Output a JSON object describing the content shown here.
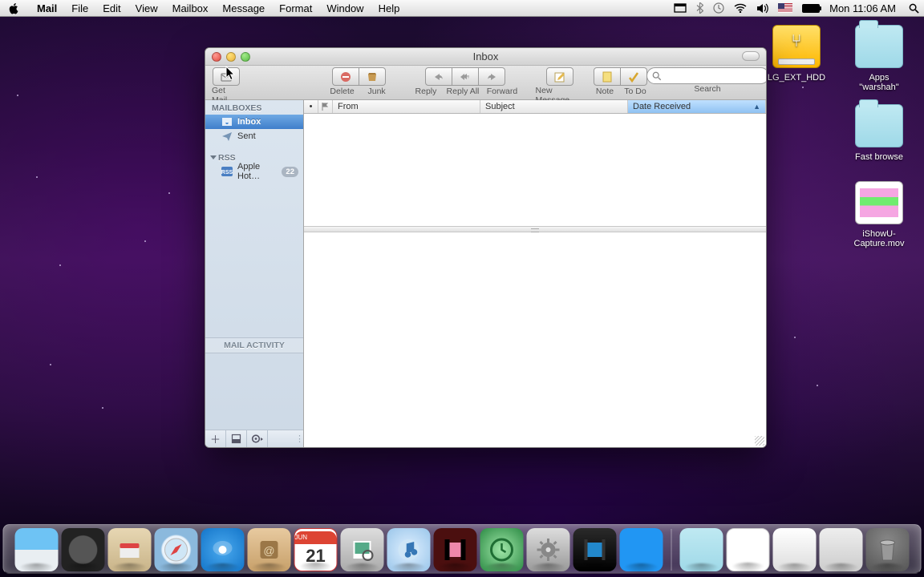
{
  "menubar": {
    "app": "Mail",
    "items": [
      "File",
      "Edit",
      "View",
      "Mailbox",
      "Message",
      "Format",
      "Window",
      "Help"
    ],
    "clock": "Mon 11:06 AM"
  },
  "desktop_icons": {
    "drive": "LG_EXT_HDD",
    "folder1_line1": "Apps",
    "folder1_line2": "\"warshah\"",
    "folder2": "Fast browse",
    "video_line1": "iShowU-",
    "video_line2": "Capture.mov"
  },
  "window": {
    "title": "Inbox",
    "toolbar": {
      "getmail": "Get Mail",
      "delete": "Delete",
      "junk": "Junk",
      "reply": "Reply",
      "replyall": "Reply All",
      "forward": "Forward",
      "newmessage": "New Message",
      "note": "Note",
      "todo": "To Do",
      "search": "Search"
    },
    "sidebar": {
      "section_mailboxes": "MAILBOXES",
      "inbox": "Inbox",
      "sent": "Sent",
      "section_rss": "RSS",
      "rss_feed": "Apple Hot…",
      "rss_count": "22",
      "activity": "MAIL ACTIVITY"
    },
    "columns": {
      "from": "From",
      "subject": "Subject",
      "date": "Date Received",
      "sort_indicator": "▲"
    },
    "calendar": {
      "month": "JUN",
      "day": "21"
    }
  }
}
